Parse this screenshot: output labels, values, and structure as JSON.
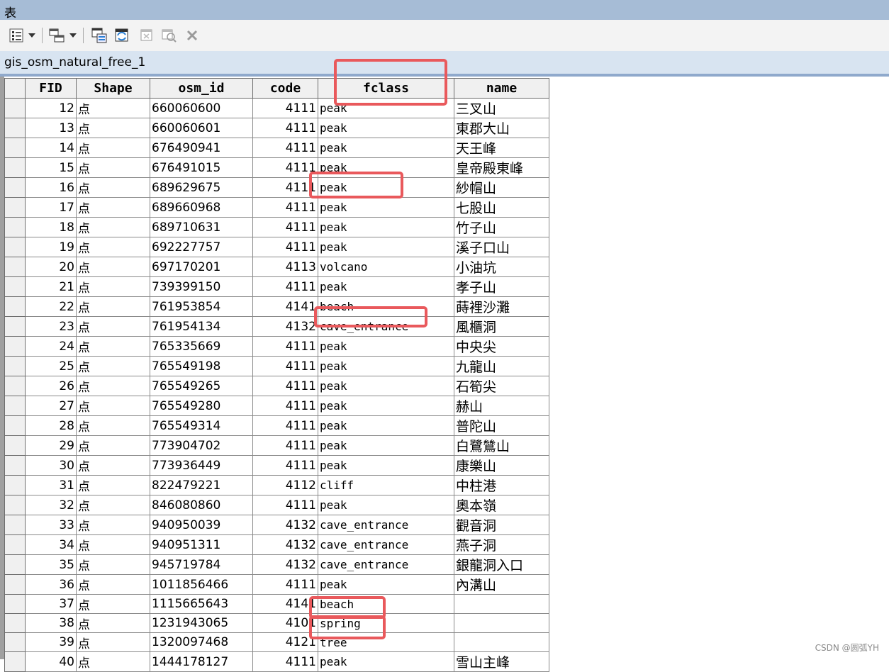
{
  "window": {
    "title": "表"
  },
  "toolbar": {
    "icons": [
      "table-options-icon",
      "dropdown-arrow-icon",
      "related-tables-icon",
      "dropdown-arrow-icon",
      "select-by-attributes-icon",
      "switch-selection-icon",
      "clear-selection-icon",
      "zoom-to-selected-icon",
      "delete-selected-icon"
    ]
  },
  "tab": {
    "label": "gis_osm_natural_free_1"
  },
  "table": {
    "headers": {
      "fid": "FID",
      "shape": "Shape",
      "osm_id": "osm_id",
      "code": "code",
      "fclass": "fclass",
      "name": "name"
    },
    "rows": [
      {
        "fid": "12",
        "shape": "点",
        "osm_id": "660060600",
        "code": "4111",
        "fclass": "peak",
        "name": "三叉山"
      },
      {
        "fid": "13",
        "shape": "点",
        "osm_id": "660060601",
        "code": "4111",
        "fclass": "peak",
        "name": "東郡大山"
      },
      {
        "fid": "14",
        "shape": "点",
        "osm_id": "676490941",
        "code": "4111",
        "fclass": "peak",
        "name": "天王峰"
      },
      {
        "fid": "15",
        "shape": "点",
        "osm_id": "676491015",
        "code": "4111",
        "fclass": "peak",
        "name": "皇帝殿東峰"
      },
      {
        "fid": "16",
        "shape": "点",
        "osm_id": "689629675",
        "code": "4111",
        "fclass": "peak",
        "name": "紗帽山"
      },
      {
        "fid": "17",
        "shape": "点",
        "osm_id": "689660968",
        "code": "4111",
        "fclass": "peak",
        "name": "七股山"
      },
      {
        "fid": "18",
        "shape": "点",
        "osm_id": "689710631",
        "code": "4111",
        "fclass": "peak",
        "name": "竹子山"
      },
      {
        "fid": "19",
        "shape": "点",
        "osm_id": "692227757",
        "code": "4111",
        "fclass": "peak",
        "name": "溪子口山"
      },
      {
        "fid": "20",
        "shape": "点",
        "osm_id": "697170201",
        "code": "4113",
        "fclass": "volcano",
        "name": "小油坑"
      },
      {
        "fid": "21",
        "shape": "点",
        "osm_id": "739399150",
        "code": "4111",
        "fclass": "peak",
        "name": "孝子山"
      },
      {
        "fid": "22",
        "shape": "点",
        "osm_id": "761953854",
        "code": "4141",
        "fclass": "beach",
        "name": "蒔裡沙灘"
      },
      {
        "fid": "23",
        "shape": "点",
        "osm_id": "761954134",
        "code": "4132",
        "fclass": "cave_entrance",
        "name": "風櫃洞"
      },
      {
        "fid": "24",
        "shape": "点",
        "osm_id": "765335669",
        "code": "4111",
        "fclass": "peak",
        "name": "中央尖"
      },
      {
        "fid": "25",
        "shape": "点",
        "osm_id": "765549198",
        "code": "4111",
        "fclass": "peak",
        "name": "九龍山"
      },
      {
        "fid": "26",
        "shape": "点",
        "osm_id": "765549265",
        "code": "4111",
        "fclass": "peak",
        "name": "石筍尖"
      },
      {
        "fid": "27",
        "shape": "点",
        "osm_id": "765549280",
        "code": "4111",
        "fclass": "peak",
        "name": "赫山"
      },
      {
        "fid": "28",
        "shape": "点",
        "osm_id": "765549314",
        "code": "4111",
        "fclass": "peak",
        "name": "普陀山"
      },
      {
        "fid": "29",
        "shape": "点",
        "osm_id": "773904702",
        "code": "4111",
        "fclass": "peak",
        "name": "白鷺鷥山"
      },
      {
        "fid": "30",
        "shape": "点",
        "osm_id": "773936449",
        "code": "4111",
        "fclass": "peak",
        "name": "康樂山"
      },
      {
        "fid": "31",
        "shape": "点",
        "osm_id": "822479221",
        "code": "4112",
        "fclass": "cliff",
        "name": "中柱港"
      },
      {
        "fid": "32",
        "shape": "点",
        "osm_id": "846080860",
        "code": "4111",
        "fclass": "peak",
        "name": "奧本嶺"
      },
      {
        "fid": "33",
        "shape": "点",
        "osm_id": "940950039",
        "code": "4132",
        "fclass": "cave_entrance",
        "name": "觀音洞"
      },
      {
        "fid": "34",
        "shape": "点",
        "osm_id": "940951311",
        "code": "4132",
        "fclass": "cave_entrance",
        "name": "燕子洞"
      },
      {
        "fid": "35",
        "shape": "点",
        "osm_id": "945719784",
        "code": "4132",
        "fclass": "cave_entrance",
        "name": "銀龍洞入口"
      },
      {
        "fid": "36",
        "shape": "点",
        "osm_id": "1011856466",
        "code": "4111",
        "fclass": "peak",
        "name": "內溝山"
      },
      {
        "fid": "37",
        "shape": "点",
        "osm_id": "1115665643",
        "code": "4141",
        "fclass": "beach",
        "name": ""
      },
      {
        "fid": "38",
        "shape": "点",
        "osm_id": "1231943065",
        "code": "4101",
        "fclass": "spring",
        "name": ""
      },
      {
        "fid": "39",
        "shape": "点",
        "osm_id": "1320097468",
        "code": "4121",
        "fclass": "tree",
        "name": ""
      },
      {
        "fid": "40",
        "shape": "点",
        "osm_id": "1444178127",
        "code": "4111",
        "fclass": "peak",
        "name": "雪山主峰"
      }
    ]
  },
  "highlight_color": "#e9595c",
  "watermark": "CSDN @圆弧YH"
}
